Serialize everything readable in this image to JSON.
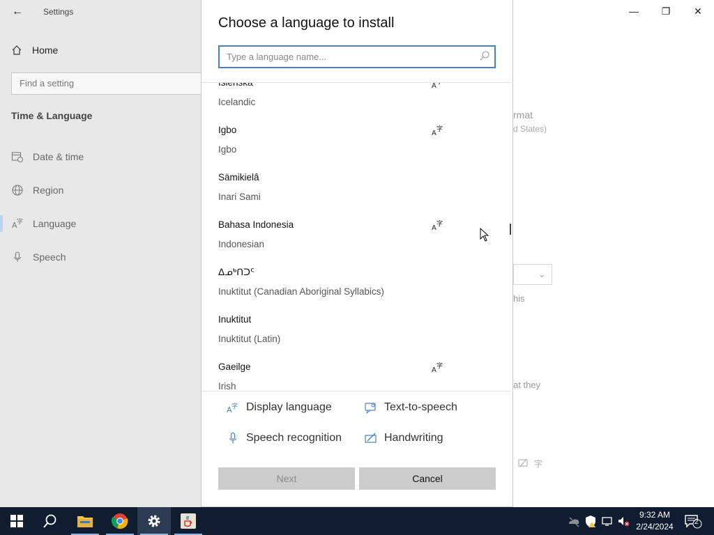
{
  "settings": {
    "window_title": "Settings",
    "back_glyph": "←",
    "home_label": "Home",
    "find_placeholder": "Find a setting",
    "section_title": "Time & Language",
    "nav": [
      {
        "label": "Date & time",
        "icon": "calendar-clock-icon"
      },
      {
        "label": "Region",
        "icon": "globe-icon"
      },
      {
        "label": "Language",
        "icon": "language-icon"
      },
      {
        "label": "Speech",
        "icon": "microphone-icon"
      }
    ],
    "active_nav": "Language",
    "bg_fragments": {
      "format": "rmat",
      "states": "d States)",
      "this": "his",
      "they": "at they"
    },
    "caption": {
      "minimize": "—",
      "restore": "❐",
      "close": "✕"
    }
  },
  "dialog": {
    "title": "Choose a language to install",
    "search_placeholder": "Type a language name...",
    "languages": [
      {
        "native": "Íslenska",
        "english": "Icelandic",
        "display_lang": true
      },
      {
        "native": "Igbo",
        "english": "Igbo",
        "display_lang": true
      },
      {
        "native": "Sämikielâ",
        "english": "Inari Sami",
        "display_lang": false
      },
      {
        "native": "Bahasa Indonesia",
        "english": "Indonesian",
        "display_lang": true
      },
      {
        "native": "ᐃᓄᒃᑎᑐᑦ",
        "english": "Inuktitut (Canadian Aboriginal Syllabics)",
        "display_lang": false
      },
      {
        "native": "Inuktitut",
        "english": "Inuktitut (Latin)",
        "display_lang": false
      },
      {
        "native": "Gaeilge",
        "english": "Irish",
        "display_lang": true
      }
    ],
    "features": {
      "display_language": "Display language",
      "text_to_speech": "Text-to-speech",
      "speech_recognition": "Speech recognition",
      "handwriting": "Handwriting"
    },
    "next_label": "Next",
    "cancel_label": "Cancel"
  },
  "taskbar": {
    "time": "9:32 AM",
    "date": "2/24/2024",
    "notification_count": "2",
    "apps": [
      "start-icon",
      "search-icon",
      "file-explorer-icon",
      "chrome-icon",
      "settings-icon",
      "java-icon"
    ]
  },
  "colors": {
    "accent": "#4a80b8",
    "taskbar": "#101c30",
    "button_gray": "#cccccc"
  }
}
